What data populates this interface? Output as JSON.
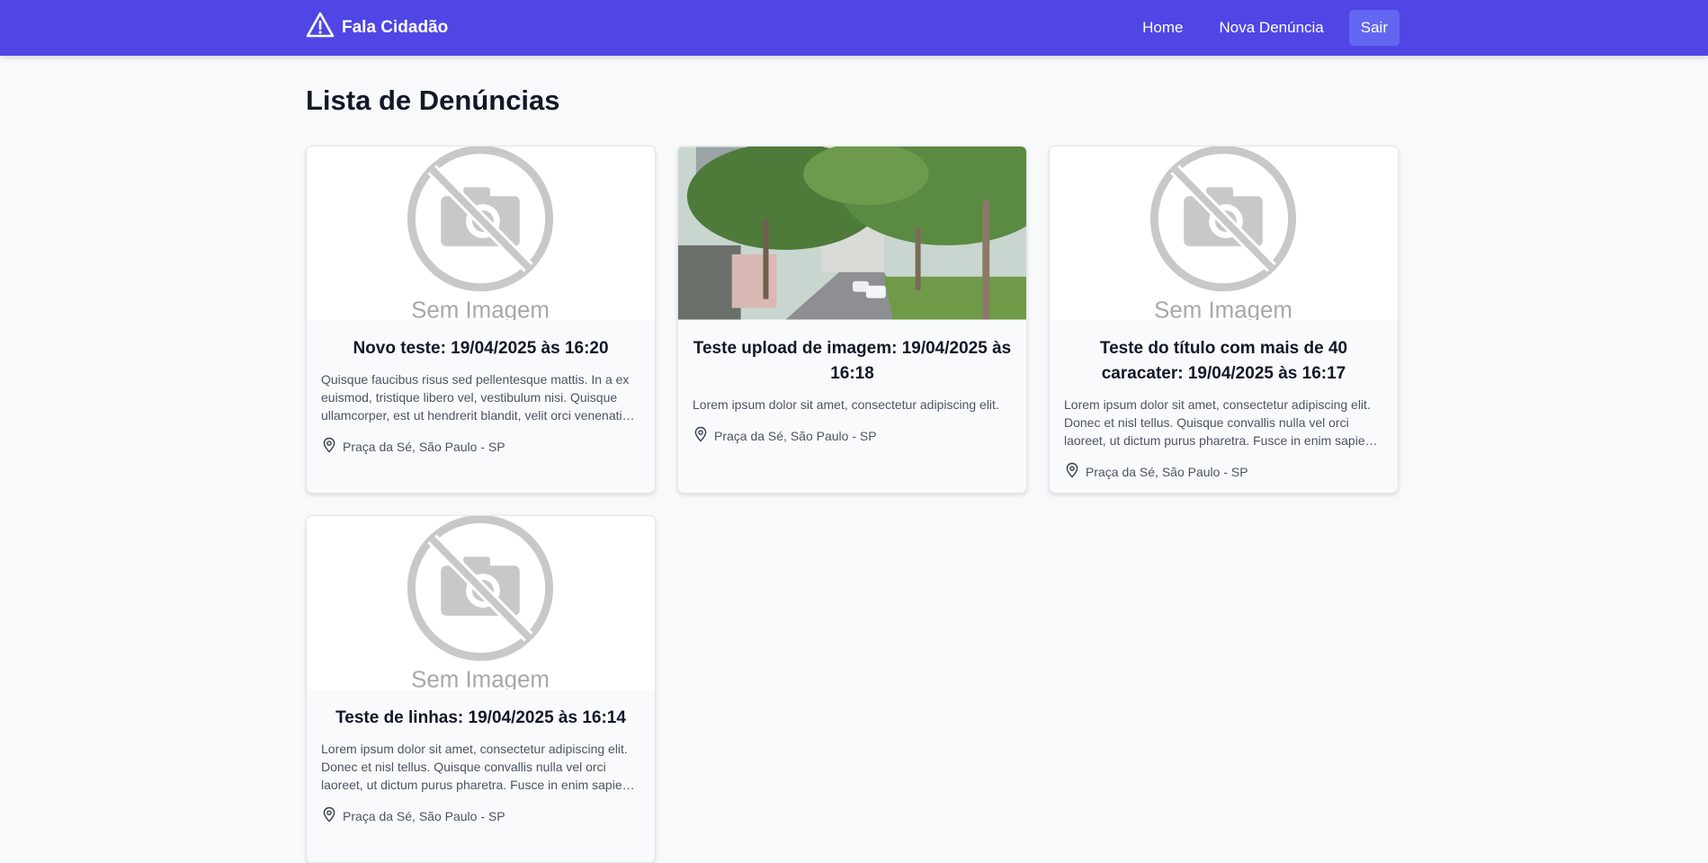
{
  "app": {
    "brand": "Fala Cidadão",
    "brand_icon": "warning-triangle-icon",
    "accent_color": "#4f46e5"
  },
  "nav": {
    "home": "Home",
    "new_report": "Nova Denúncia",
    "logout": "Sair"
  },
  "page": {
    "title": "Lista de Denúncias"
  },
  "placeholder": {
    "text": "Sem Imagem"
  },
  "cards": [
    {
      "title": "Novo teste: 19/04/2025 às 16:20",
      "description": "Quisque faucibus risus sed pellentesque mattis. In a ex euismod, tristique libero vel, vestibulum nisi. Quisque ullamcorper, est ut hendrerit blandit, velit orci venenatis nibh, at fermentum elit lorem nec turpis.",
      "location": "Praça da Sé, São Paulo - SP",
      "has_image": false
    },
    {
      "title": "Teste upload de imagem: 19/04/2025 às 16:18",
      "description": "Lorem ipsum dolor sit amet, consectetur adipiscing elit.",
      "location": "Praça da Sé, São Paulo - SP",
      "has_image": true
    },
    {
      "title": "Teste do título com mais de 40 caracater: 19/04/2025 às 16:17",
      "description": "Lorem ipsum dolor sit amet, consectetur adipiscing elit. Donec et nisl tellus. Quisque convallis nulla vel orci laoreet, ut dictum purus pharetra. Fusce in enim sapien. Nulla facilisi.",
      "location": "Praça da Sé, São Paulo - SP",
      "has_image": false
    },
    {
      "title": "Teste de linhas: 19/04/2025 às 16:14",
      "description": "Lorem ipsum dolor sit amet, consectetur adipiscing elit. Donec et nisl tellus. Quisque convallis nulla vel orci laoreet, ut dictum purus pharetra. Fusce in enim sapien. Nulla facilisi.",
      "location": "Praça da Sé, São Paulo - SP",
      "has_image": false
    }
  ]
}
